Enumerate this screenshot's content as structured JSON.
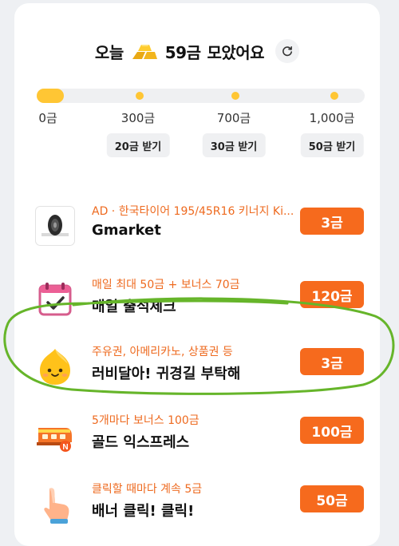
{
  "header": {
    "prefix": "오늘",
    "amount": "59금",
    "suffix": "모았어요",
    "gold_icon": "gold-bars-icon",
    "refresh_icon": "refresh-icon"
  },
  "progress": {
    "fraction": 0.0,
    "milestones": [
      {
        "label": "0금"
      },
      {
        "label": "300금",
        "button": "20금 받기"
      },
      {
        "label": "700금",
        "button": "30금 받기"
      },
      {
        "label": "1,000금",
        "button": "50금 받기"
      }
    ]
  },
  "items": [
    {
      "sub": "AD · 한국타이어 195/45R16 키너지 Ki...",
      "title": "Gmarket",
      "reward": "3금",
      "icon": "tire-icon"
    },
    {
      "sub": "매일 최대 50금 + 보너스 70금",
      "title": "매일 출석체크",
      "reward": "120금",
      "icon": "calendar-check-icon"
    },
    {
      "sub": "주유권, 아메리카노, 상품권 등",
      "title": "러비달아! 귀경길 부탁해",
      "reward": "3금",
      "icon": "lemon-character-icon"
    },
    {
      "sub": "5개마다 보너스 100금",
      "title": "골드 익스프레스",
      "reward": "100금",
      "icon": "train-icon"
    },
    {
      "sub": "클릭할 때마다 계속 5금",
      "title": "배너 클릭! 클릭!",
      "reward": "50금",
      "icon": "pointing-hand-icon"
    }
  ],
  "colors": {
    "accent": "#f66a1d",
    "sub_text": "#ee6a1f",
    "progress": "#ffc634",
    "highlight_circle": "#66b52a"
  }
}
